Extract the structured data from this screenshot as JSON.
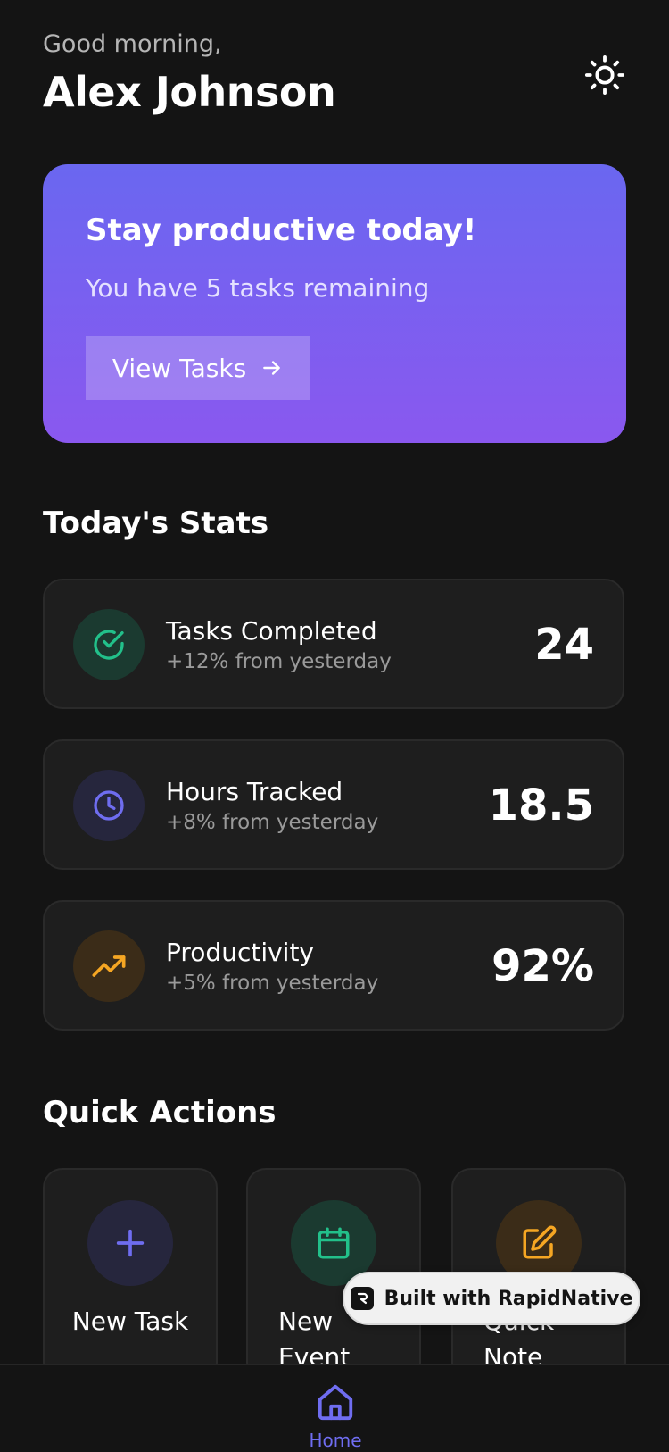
{
  "header": {
    "greeting": "Good morning,",
    "user_name": "Alex Johnson",
    "theme_icon": "sun-icon"
  },
  "hero": {
    "title": "Stay productive today!",
    "subtitle": "You have 5 tasks remaining",
    "button_label": "View Tasks",
    "button_icon": "arrow-right-icon",
    "gradient_from": "#6a67f0",
    "gradient_to": "#8a58ef"
  },
  "stats": {
    "title": "Today's Stats",
    "items": [
      {
        "label": "Tasks Completed",
        "change": "+12% from yesterday",
        "value": "24",
        "icon": "check-circle-icon",
        "color": "#22c08a"
      },
      {
        "label": "Hours Tracked",
        "change": "+8% from yesterday",
        "value": "18.5",
        "icon": "clock-icon",
        "color": "#6f6df0"
      },
      {
        "label": "Productivity",
        "change": "+5% from yesterday",
        "value": "92%",
        "icon": "trending-up-icon",
        "color": "#f5a623"
      }
    ]
  },
  "quick_actions": {
    "title": "Quick Actions",
    "items": [
      {
        "label": "New Task",
        "icon": "plus-icon",
        "color": "#6f6df0"
      },
      {
        "label": "New Event",
        "icon": "calendar-icon",
        "color": "#22c08a"
      },
      {
        "label": "Quick Note",
        "icon": "edit-icon",
        "color": "#f5a623"
      }
    ]
  },
  "badge": {
    "text": "Built with RapidNative"
  },
  "nav": {
    "home_label": "Home",
    "active_color": "#6f6df0"
  }
}
